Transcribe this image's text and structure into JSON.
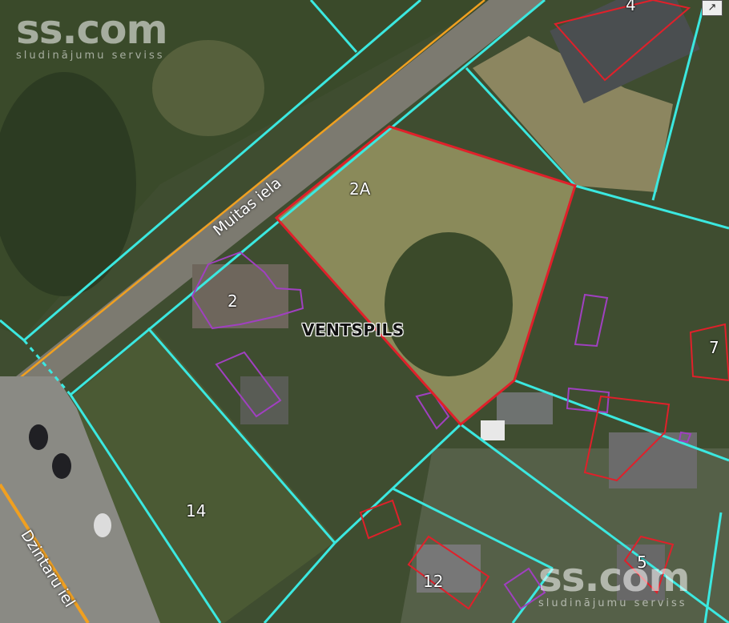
{
  "watermark": {
    "brand": "ss.com",
    "tagline": "sludinājumu serviss"
  },
  "city_label": "VENTSPILS",
  "streets": {
    "muitas": "Muitas iela",
    "dzintaru": "Dzintaru iel"
  },
  "parcels": {
    "p2a": "2A",
    "p2": "2",
    "p4": "4",
    "p5": "5",
    "p7": "7",
    "p12": "12",
    "p14": "14"
  },
  "controls": {
    "expand_icon": "expand-arrow-icon"
  },
  "colors": {
    "boundary": "#3be8e0",
    "selected_parcel": "#e0202a",
    "building": "#a040c0",
    "road_line": "#f0a020"
  }
}
